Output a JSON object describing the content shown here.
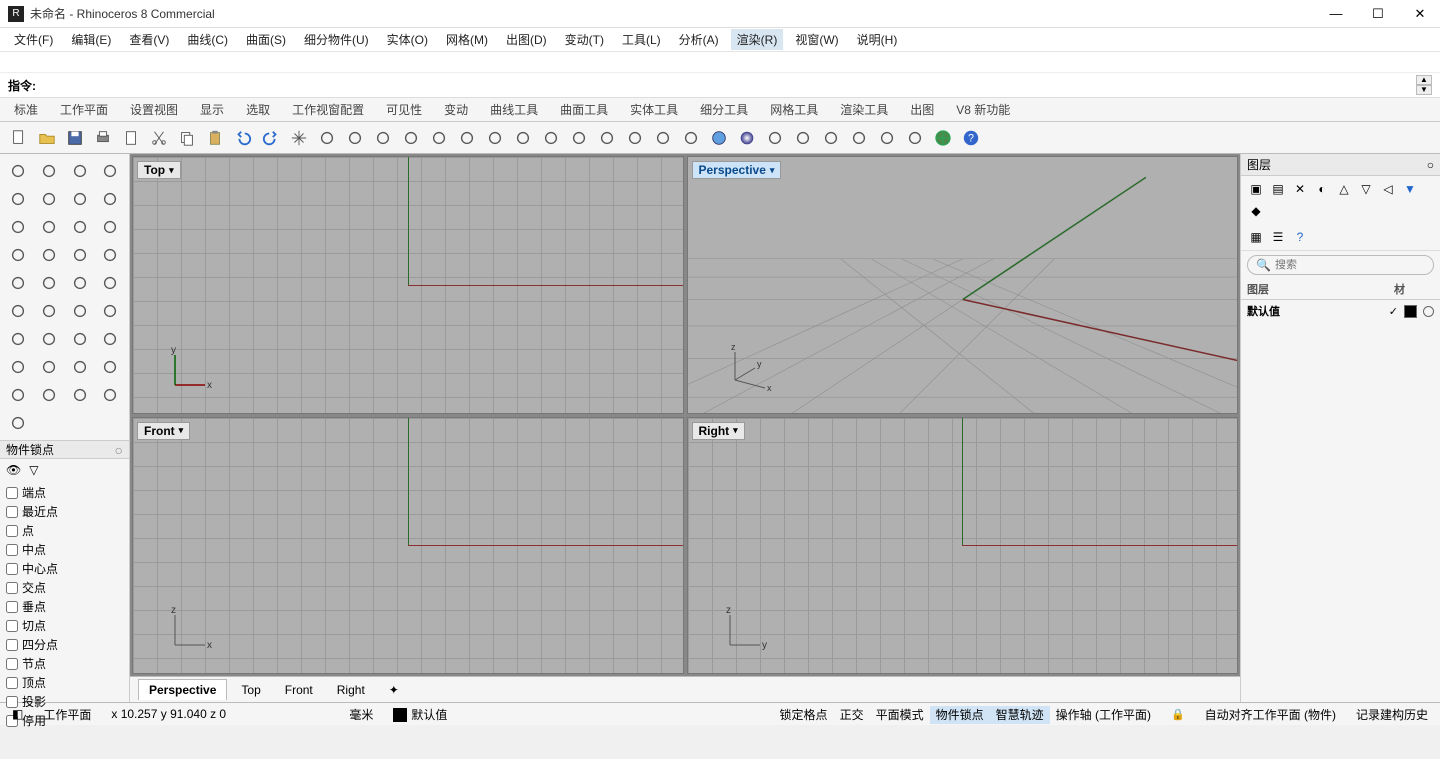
{
  "title": "未命名 - Rhinoceros 8 Commercial",
  "menus": [
    "文件(F)",
    "编辑(E)",
    "查看(V)",
    "曲线(C)",
    "曲面(S)",
    "细分物件(U)",
    "实体(O)",
    "网格(M)",
    "出图(D)",
    "变动(T)",
    "工具(L)",
    "分析(A)",
    "渲染(R)",
    "视窗(W)",
    "说明(H)"
  ],
  "menu_hover_index": 12,
  "command": {
    "label": "指令:",
    "value": ""
  },
  "tabs": [
    "标准",
    "工作平面",
    "设置视图",
    "显示",
    "选取",
    "工作视窗配置",
    "可见性",
    "变动",
    "曲线工具",
    "曲面工具",
    "实体工具",
    "细分工具",
    "网格工具",
    "渲染工具",
    "出图",
    "V8 新功能"
  ],
  "toolbar_icons": [
    "new",
    "open",
    "save",
    "print",
    "file",
    "cut",
    "copy",
    "paste",
    "undo",
    "redo",
    "pan",
    "rotate",
    "zoom-dyn",
    "zoom-win",
    "zoom-ext",
    "zoom-sel",
    "zoom-scale",
    "target",
    "4view",
    "car",
    "cplane",
    "cull",
    "sun",
    "light",
    "layer",
    "render",
    "sphere",
    "material",
    "env",
    "mat-icon",
    "bolt",
    "gear",
    "print2",
    "globe",
    "help"
  ],
  "left_tools": [
    "pointer",
    "lasso",
    "line",
    "polyline",
    "circle",
    "ellipse",
    "arc",
    "rect",
    "curve",
    "sweep",
    "surf1",
    "surf2",
    "box",
    "cyl",
    "cone",
    "torus",
    "sphere-s",
    "pipe",
    "bool-u",
    "bool-d",
    "boom",
    "subd",
    "mesh1",
    "poly",
    "mesh2",
    "text",
    "dim",
    "dim2",
    "dim3",
    "group",
    "array",
    "ptgrid",
    "snap",
    "mirror",
    "rotate-t",
    "check",
    "arrow2"
  ],
  "osnap": {
    "title": "物件锁点",
    "items": [
      "端点",
      "最近点",
      "点",
      "中点",
      "中心点",
      "交点",
      "垂点",
      "切点",
      "四分点",
      "节点",
      "顶点",
      "投影",
      "停用"
    ]
  },
  "viewports": {
    "top": "Top",
    "perspective": "Perspective",
    "front": "Front",
    "right": "Right",
    "active": "perspective",
    "tabs": [
      "Perspective",
      "Top",
      "Front",
      "Right"
    ],
    "active_tab": 0
  },
  "layers": {
    "title": "图层",
    "search_placeholder": "搜索",
    "headers": {
      "name": "图层",
      "material": "材"
    },
    "default_layer": "默认值"
  },
  "status": {
    "cplane": "工作平面",
    "coords": "x 10.257  y 91.040  z 0",
    "units": "毫米",
    "layer": "默认值",
    "toggles": [
      {
        "label": "锁定格点",
        "on": false
      },
      {
        "label": "正交",
        "on": false
      },
      {
        "label": "平面模式",
        "on": false
      },
      {
        "label": "物件锁点",
        "on": true
      },
      {
        "label": "智慧轨迹",
        "on": true
      },
      {
        "label": "操作轴 (工作平面)",
        "on": false
      }
    ],
    "right": [
      "自动对齐工作平面 (物件)",
      "记录建构历史"
    ]
  }
}
